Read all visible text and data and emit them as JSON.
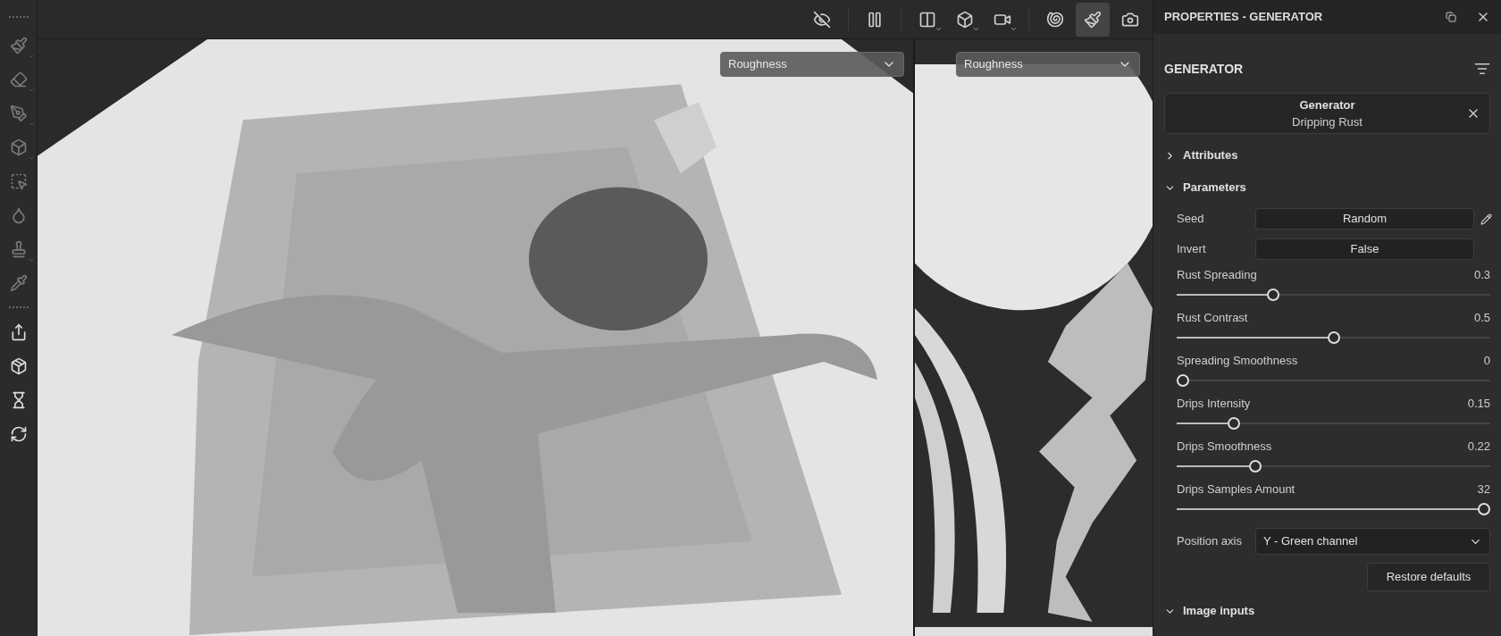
{
  "left_toolbar": [
    {
      "selected": false
    },
    {
      "selected": false
    },
    {
      "selected": false
    },
    {
      "selected": false
    },
    {
      "selected": false
    },
    {
      "selected": false
    },
    {
      "selected": false
    },
    {
      "selected": false
    }
  ],
  "top_toolbar": [
    {
      "selected": false
    },
    {
      "selected": false
    },
    {
      "selected": false
    },
    {
      "selected": false
    },
    {
      "selected": false
    },
    {
      "selected": false
    },
    {
      "selected": true
    },
    {
      "selected": false
    }
  ],
  "viewports": [
    {
      "kind": "model",
      "channel": "Roughness"
    },
    {
      "kind": "uv",
      "channel": "Roughness"
    }
  ],
  "panel": {
    "title": "PROPERTIES - GENERATOR",
    "section": "GENERATOR",
    "generator": {
      "title": "Generator",
      "name": "Dripping Rust"
    },
    "groups": [
      {
        "label": "Attributes",
        "expanded": false
      },
      {
        "label": "Parameters",
        "expanded": true,
        "parameters": [
          {
            "kind": "button",
            "label": "Seed",
            "value": "Random",
            "editable": true
          },
          {
            "kind": "button",
            "label": "Invert",
            "value": "False",
            "editable": false
          },
          {
            "kind": "slider",
            "label": "Rust Spreading",
            "value": "0.3",
            "level": 0.3
          },
          {
            "kind": "slider",
            "label": "Rust Contrast",
            "value": "0.5",
            "level": 0.5
          },
          {
            "kind": "slider",
            "label": "Spreading Smoothness",
            "value": "0",
            "level": 0
          },
          {
            "kind": "slider",
            "label": "Drips Intensity",
            "value": "0.15",
            "level": 0.17
          },
          {
            "kind": "slider",
            "label": "Drips Smoothness",
            "value": "0.22",
            "level": 0.24
          },
          {
            "kind": "slider",
            "label": "Drips Samples Amount",
            "value": "32",
            "level": 1
          },
          {
            "kind": "dropdown",
            "label": "Position axis",
            "value": "Y - Green channel"
          }
        ],
        "restore": "Restore defaults"
      },
      {
        "label": "Image inputs",
        "expanded": true
      }
    ]
  }
}
